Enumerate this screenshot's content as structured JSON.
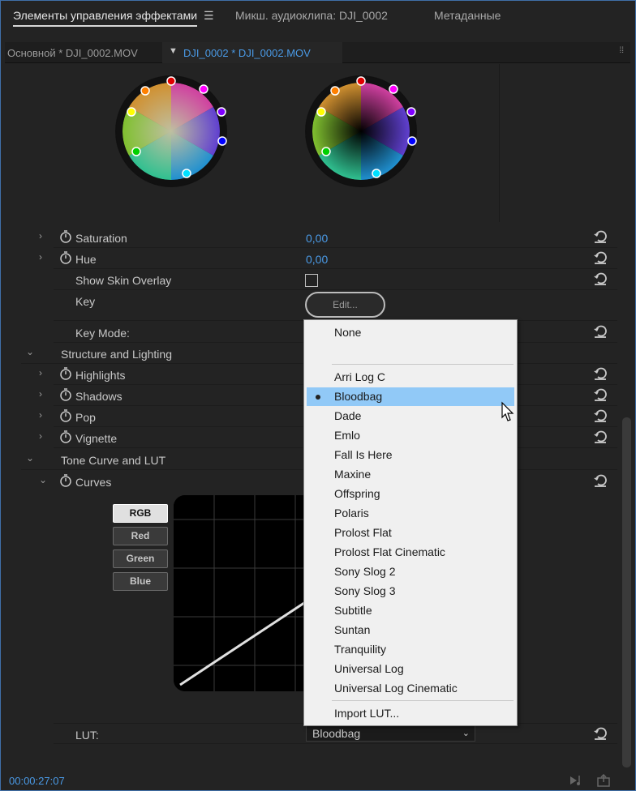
{
  "tabs": [
    {
      "label": "Элементы управления эффектами",
      "active": true
    },
    {
      "label": "Микш. аудиоклипа: DJI_0002",
      "active": false
    },
    {
      "label": "Метаданные",
      "active": false
    }
  ],
  "subtabs": {
    "master": "Основной * DJI_0002.MOV",
    "sequence": "DJI_0002 * DJI_0002.MOV"
  },
  "params": {
    "saturation": {
      "label": "Saturation",
      "value": "0,00"
    },
    "hue": {
      "label": "Hue",
      "value": "0,00"
    },
    "show_skin": {
      "label": "Show Skin Overlay"
    },
    "key": {
      "label": "Key",
      "button": "Edit..."
    },
    "key_mode": {
      "label": "Key Mode:"
    }
  },
  "sections": {
    "structure": "Structure and Lighting",
    "tone": "Tone Curve and LUT"
  },
  "structure_items": [
    "Highlights",
    "Shadows",
    "Pop",
    "Vignette"
  ],
  "curves": {
    "label": "Curves",
    "buttons": [
      "RGB",
      "Red",
      "Green",
      "Blue"
    ]
  },
  "lut": {
    "label": "LUT:",
    "value": "Bloodbag"
  },
  "dropdown": {
    "none": "None",
    "items": [
      "Arri Log C",
      "Bloodbag",
      "Dade",
      "Emlo",
      "Fall Is Here",
      "Maxine",
      "Offspring",
      "Polaris",
      "Prolost Flat",
      "Prolost Flat Cinematic",
      "Sony Slog 2",
      "Sony Slog 3",
      "Subtitle",
      "Suntan",
      "Tranquility",
      "Universal Log",
      "Universal Log Cinematic"
    ],
    "selected": "Bloodbag",
    "import": "Import LUT..."
  },
  "status": {
    "timecode": "00:00:27:07"
  },
  "colors": {
    "accent": "#4a9ae6",
    "selection": "#91c9f7"
  }
}
